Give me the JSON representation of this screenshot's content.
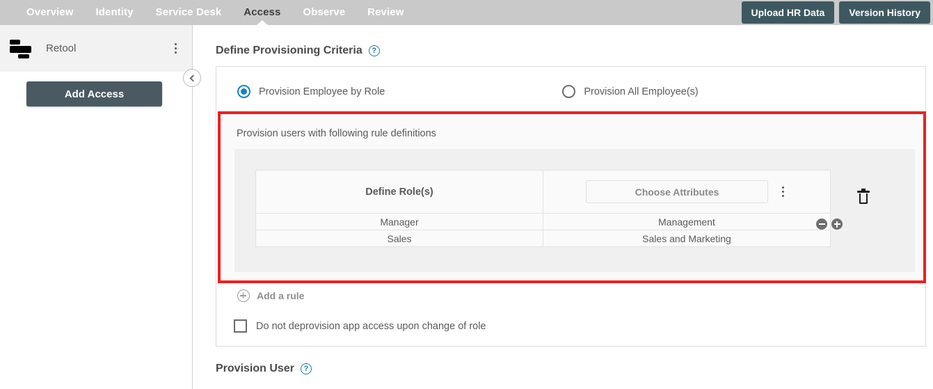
{
  "topbar": {
    "nav_items": [
      {
        "label": "Overview",
        "active": false
      },
      {
        "label": "Identity",
        "active": false
      },
      {
        "label": "Service Desk",
        "active": false
      },
      {
        "label": "Access",
        "active": true
      },
      {
        "label": "Observe",
        "active": false
      },
      {
        "label": "Review",
        "active": false
      }
    ],
    "upload_button": "Upload HR Data",
    "version_button": "Version History",
    "bg_color": "#c9c9c9",
    "button_color": "#3e5861"
  },
  "sidebar": {
    "app_name": "Retool",
    "app_logo": "retool-logo",
    "kebab_icon": "more-vertical-icon",
    "collapse_icon": "chevron-left-icon",
    "add_access_button": "Add Access"
  },
  "main": {
    "section_title": "Define Provisioning Criteria",
    "help_icon": "help-circle-icon",
    "radio_options": [
      {
        "label": "Provision Employee by Role",
        "selected": true
      },
      {
        "label": "Provision All Employee(s)",
        "selected": false
      }
    ],
    "rule_caption": "Provision users with following rule definitions",
    "table": {
      "headers": [
        "Define Role(s)",
        "Choose Attributes"
      ],
      "attributes_placeholder": "Choose Attributes",
      "column_kebab_icon": "more-vertical-icon",
      "rows": [
        {
          "role": "Manager",
          "attribute": "Management"
        },
        {
          "role": "Sales",
          "attribute": "Sales and Marketing"
        }
      ]
    },
    "delete_icon": "trash-icon",
    "remove_row_icon": "minus-circle-icon",
    "add_row_icon": "plus-circle-icon",
    "add_rule_label": "Add a rule",
    "add_rule_icon": "plus-circle-outline-icon",
    "deprovision_checkbox": {
      "label": "Do not deprovision app access upon change of role",
      "checked": false
    },
    "highlight_color": "#ee2020",
    "accent_color": "#1284c4"
  },
  "bottom": {
    "section_title": "Provision User",
    "help_icon": "help-circle-icon"
  }
}
